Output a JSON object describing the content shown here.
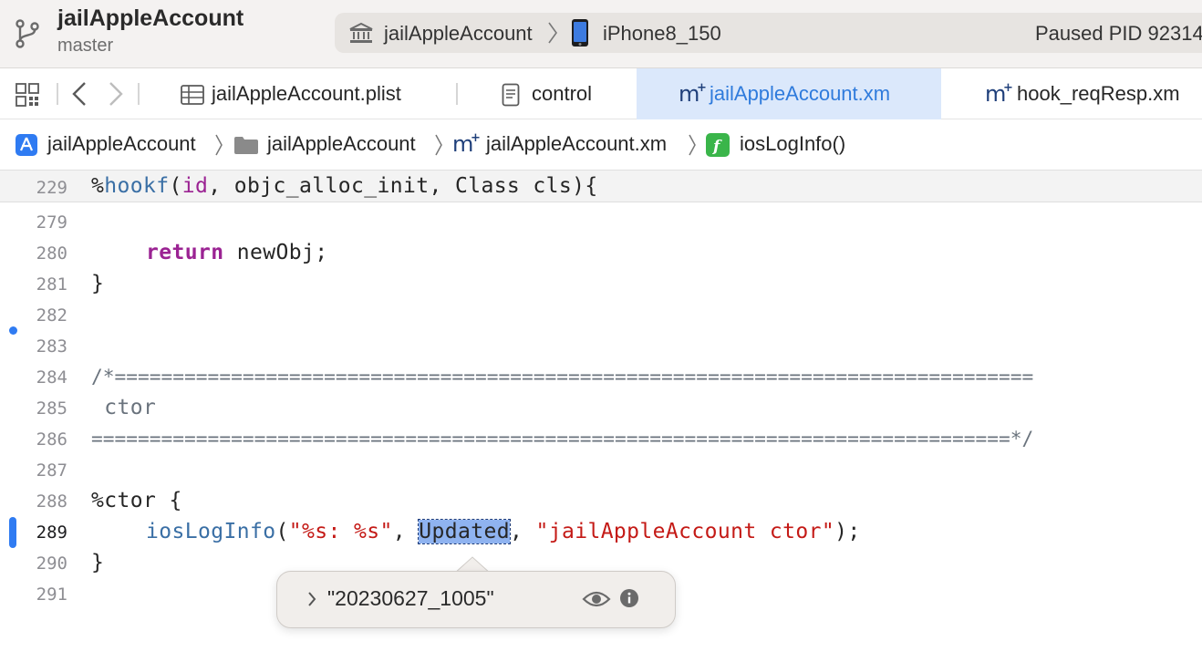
{
  "titlebar": {
    "project": "jailAppleAccount",
    "branch": "master",
    "scheme": "jailAppleAccount",
    "device": "iPhone8_150",
    "status": "Paused PID 92314"
  },
  "tabs": [
    {
      "label": "jailAppleAccount.plist",
      "icon": "table-icon"
    },
    {
      "label": "control",
      "icon": "document-icon"
    },
    {
      "label": "jailAppleAccount.xm",
      "icon": "m-plus-icon",
      "active": true
    },
    {
      "label": "hook_reqResp.xm",
      "icon": "m-plus-icon"
    }
  ],
  "jumpbar": {
    "project": "jailAppleAccount",
    "folder": "jailAppleAccount",
    "file": "jailAppleAccount.xm",
    "function": "iosLogInfo()"
  },
  "editor": {
    "sticky_line_number": "229",
    "sticky_parts": [
      "%",
      "hookf",
      "(",
      "id",
      ", objc_alloc_init, Class cls){"
    ],
    "lines": [
      {
        "n": "279"
      },
      {
        "n": "280",
        "kw": "return",
        "rest": " newObj;"
      },
      {
        "n": "281",
        "text": "}"
      },
      {
        "n": "282"
      },
      {
        "n": "283"
      },
      {
        "n": "284",
        "comment": "/*==============================================================================="
      },
      {
        "n": "285",
        "comment": " ctor"
      },
      {
        "n": "286",
        "comment": "===============================================================================*/"
      },
      {
        "n": "287"
      },
      {
        "n": "288",
        "text": "%ctor {"
      },
      {
        "n": "289",
        "fn": "iosLogInfo",
        "open": "(",
        "str1": "\"%s: %s\"",
        "comma1": ", ",
        "selected": "Updated",
        "comma2": ", ",
        "str2": "\"jailAppleAccount ctor\"",
        "close": ");"
      },
      {
        "n": "290",
        "text": "}"
      },
      {
        "n": "291"
      }
    ]
  },
  "popover": {
    "value": "\"20230627_1005\""
  },
  "colors": {
    "accent": "#2f7bdc",
    "active_tab_bg": "#dbe8fb",
    "keyword": "#9b2393",
    "string": "#c41a16",
    "function": "#3a6fa5",
    "selection": "#8fb3f0"
  }
}
